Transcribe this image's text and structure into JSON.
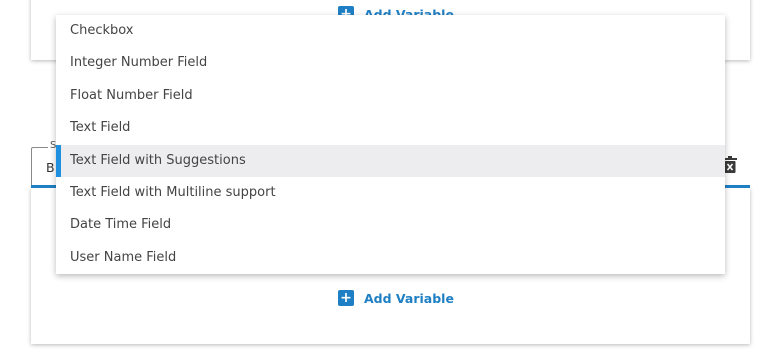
{
  "add_variable_label": "Add Variable",
  "field": {
    "legend": "S",
    "value": "B"
  },
  "dropdown": {
    "options": [
      "Checkbox",
      "Integer Number Field",
      "Float Number Field",
      "Text Field",
      "Text Field with Suggestions",
      "Text Field with Multiline support",
      "Date Time Field",
      "User Name Field"
    ],
    "highlighted": "Text Field with Suggestions"
  },
  "icons": {
    "add": "plus-square-icon",
    "delete": "trash-icon"
  },
  "colors": {
    "accent": "#1f7fc4",
    "highlight_bar": "#1f8fe0",
    "highlight_bg": "#ededef"
  }
}
